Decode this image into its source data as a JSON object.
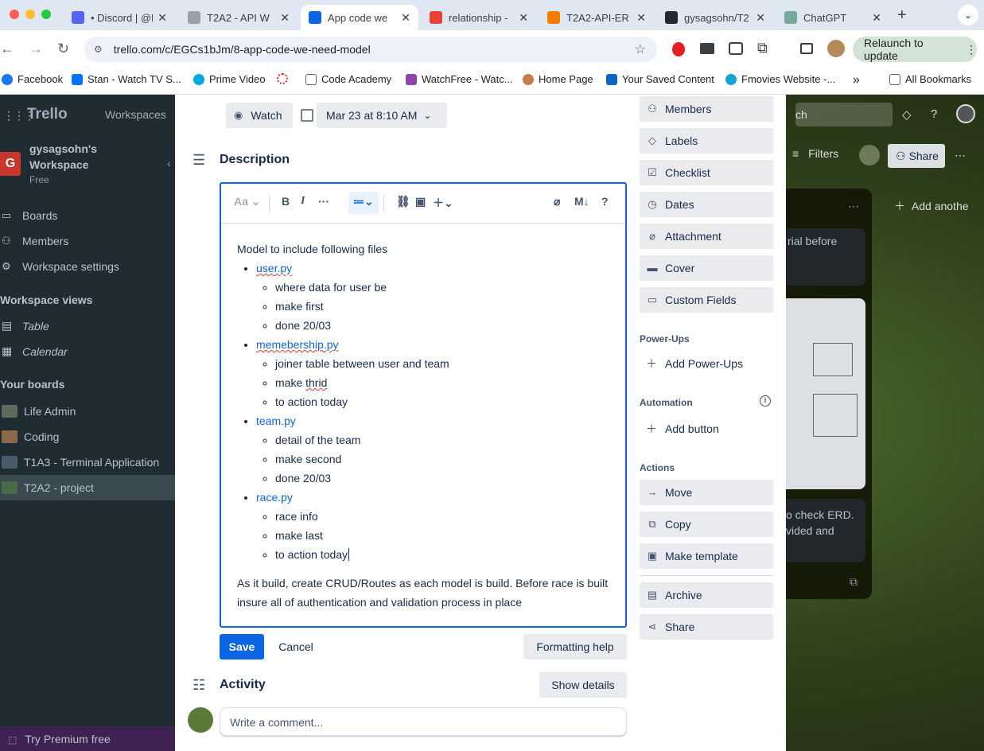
{
  "browser": {
    "tabs": [
      {
        "title": "• Discord | @H",
        "fav_color": "#5865f2"
      },
      {
        "title": "T2A2 - API W",
        "fav_color": "#9aa0a6"
      },
      {
        "title": "App code we",
        "fav_color": "#0c66e4"
      },
      {
        "title": "relationship -",
        "fav_color": "#ea4335"
      },
      {
        "title": "T2A2-API-ER",
        "fav_color": "#f57c00"
      },
      {
        "title": "gysagsohn/T2",
        "fav_color": "#24292f"
      },
      {
        "title": "ChatGPT",
        "fav_color": "#74aa9c"
      }
    ],
    "url": "trello.com/c/EGCs1bJm/8-app-code-we-need-model",
    "relaunch_label": "Relaunch to update",
    "bookmarks": [
      "Facebook",
      "Stan - Watch TV S...",
      "Prime Video",
      "Code Academy",
      "WatchFree - Watc...",
      "Home Page",
      "Your Saved Content",
      "Fmovies Website -...",
      "All Bookmarks"
    ]
  },
  "trello": {
    "logo": "Trello",
    "workspaces_label": "Workspaces",
    "workspace_initial": "G",
    "workspace_name": "gysagsohn's Workspace",
    "workspace_plan": "Free",
    "nav": [
      "Boards",
      "Members",
      "Workspace settings"
    ],
    "views_heading": "Workspace views",
    "views": [
      "Table",
      "Calendar"
    ],
    "boards_heading": "Your boards",
    "boards": [
      "Life Admin",
      "Coding",
      "T1A3 - Terminal Application",
      "T2A2 - project"
    ],
    "premium": "Try Premium free",
    "search_placeholder": "ch",
    "filters": "Filters",
    "share": "Share",
    "add_another": "Add anothe",
    "bg_card_1": "rial before",
    "bg_card_2": "o check ERD. vided and"
  },
  "card": {
    "watch_label": "Watch",
    "due_date": "Mar 23 at 8:10 AM",
    "description_heading": "Description",
    "editor": {
      "font_label": "Aa",
      "intro": "Model to include following files",
      "items": [
        {
          "name": "user.py",
          "spell": true,
          "sub": [
            "where data for user be",
            "make first",
            "done 20/03"
          ]
        },
        {
          "name": "memebership.py",
          "spell": true,
          "sub": [
            "joiner table between user and team",
            "make thrid",
            "to action today"
          ]
        },
        {
          "name": "team.py",
          "spell": false,
          "sub": [
            "detail of the team",
            "make second",
            "done 20/03"
          ]
        },
        {
          "name": "race.py",
          "spell": false,
          "sub": [
            "race info",
            "make last",
            "to action today"
          ]
        }
      ],
      "outro": "As it build, create CRUD/Routes as each model is build. Before race is built insure all of authentication and validation process in place"
    },
    "save": "Save",
    "cancel": "Cancel",
    "formatting_help": "Formatting help",
    "activity_heading": "Activity",
    "show_details": "Show details",
    "comment_placeholder": "Write a comment...",
    "sidebar": {
      "add_to_card": [
        "Members",
        "Labels",
        "Checklist",
        "Dates",
        "Attachment",
        "Cover",
        "Custom Fields"
      ],
      "powerups_heading": "Power-Ups",
      "add_powerups": "Add Power-Ups",
      "automation_heading": "Automation",
      "add_button": "Add button",
      "actions_heading": "Actions",
      "actions": [
        "Move",
        "Copy",
        "Make template",
        "Archive",
        "Share"
      ]
    }
  },
  "colors": {
    "accent": "#0c66e4",
    "workspace_badge": "#c9372c"
  }
}
